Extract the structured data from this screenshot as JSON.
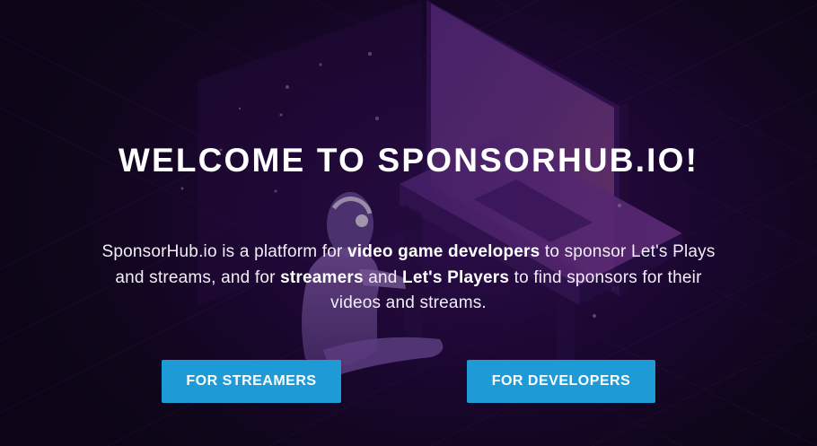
{
  "hero": {
    "title": "WELCOME TO SPONSORHUB.IO!",
    "intro": {
      "t1": "SponsorHub.io is a platform for ",
      "b1": "video game developers",
      "t2": " to sponsor Let's Plays and streams, and for ",
      "b2": "streamers",
      "t3": " and ",
      "b3": "Let's Players",
      "t4": " to find sponsors for their videos and streams."
    },
    "buttons": {
      "streamers": "FOR STREAMERS",
      "developers": "FOR DEVELOPERS"
    }
  },
  "colors": {
    "background": "#14081f",
    "accent_purple": "#3a1262",
    "button": "#1e9bd7",
    "text": "#ffffff"
  },
  "illustration": {
    "subject": "gamer-with-headphones-at-desk-with-monitor"
  }
}
